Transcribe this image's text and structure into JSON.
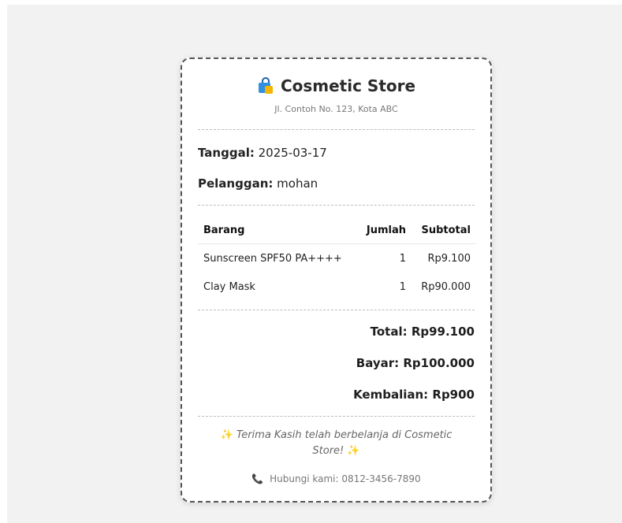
{
  "store": {
    "name": "Cosmetic Store",
    "address": "Jl. Contoh No. 123, Kota ABC",
    "icon": "shopping-bag-icon"
  },
  "info": {
    "date_label": "Tanggal:",
    "date_value": "2025-03-17",
    "customer_label": "Pelanggan:",
    "customer_value": "mohan"
  },
  "table": {
    "headers": [
      "Barang",
      "Jumlah",
      "Subtotal"
    ],
    "rows": [
      {
        "item": "Sunscreen SPF50 PA++++",
        "qty": "1",
        "subtotal": "Rp9.100"
      },
      {
        "item": "Clay Mask",
        "qty": "1",
        "subtotal": "Rp90.000"
      }
    ]
  },
  "totals": {
    "total": "Total: Rp99.100",
    "paid": "Bayar: Rp100.000",
    "change": "Kembalian: Rp900"
  },
  "footer": {
    "sparkle": "✨",
    "thanks": "Terima Kasih telah berbelanja di Cosmetic Store!",
    "phone_icon": "📞",
    "contact": "Hubungi kami: 0812-3456-7890"
  },
  "colors": {
    "background": "#f2f2f2",
    "card": "#ffffff",
    "border": "#555555",
    "phone": "#e53935",
    "sparkle": "#f4b400"
  }
}
